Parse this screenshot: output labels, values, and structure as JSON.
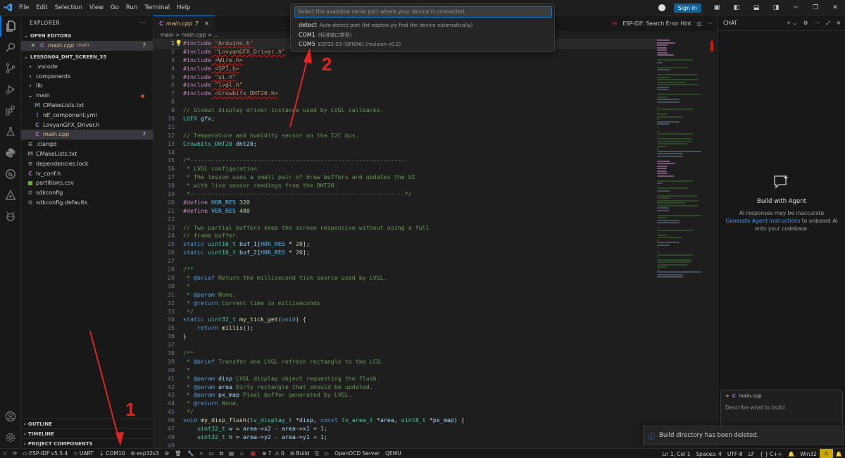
{
  "menu": [
    "File",
    "Edit",
    "Selection",
    "View",
    "Go",
    "Run",
    "Terminal",
    "Help"
  ],
  "title_right": {
    "sign_in": "Sign In"
  },
  "quickpick": {
    "placeholder": "Select the available serial port where your device is connected.",
    "items": [
      {
        "label": "detect",
        "desc": "Auto-detect port (let esptool.py find the device automatically)"
      },
      {
        "label": "COM1",
        "desc": "(标准端口类型)"
      },
      {
        "label": "COM5",
        "desc": "ESP32-S3 (QFN56) (revision v0.2)"
      }
    ]
  },
  "sidebar": {
    "header": "EXPLORER",
    "open_editors": "OPEN EDITORS",
    "open_file": {
      "name": "main.cpp",
      "folder": "main",
      "badge": "7"
    },
    "project": "LESSON04_DHT_SCREEN_35",
    "tree": [
      {
        "name": ".vscode",
        "kind": "folder",
        "depth": 1
      },
      {
        "name": "components",
        "kind": "folder",
        "depth": 1
      },
      {
        "name": "lib",
        "kind": "folder",
        "depth": 1
      },
      {
        "name": "main",
        "kind": "folder-open",
        "depth": 1
      },
      {
        "name": "CMakeLists.txt",
        "kind": "cmake",
        "depth": 2
      },
      {
        "name": "idf_component.yml",
        "kind": "yml",
        "depth": 2
      },
      {
        "name": "LovyanGFX_Driver.h",
        "kind": "h",
        "depth": 2
      },
      {
        "name": "main.cpp",
        "kind": "cpp",
        "depth": 2,
        "badge": "7"
      },
      {
        "name": ".clangd",
        "kind": "file",
        "depth": 1
      },
      {
        "name": "CMakeLists.txt",
        "kind": "cmake",
        "depth": 1
      },
      {
        "name": "dependencies.lock",
        "kind": "file",
        "depth": 1
      },
      {
        "name": "lv_conf.h",
        "kind": "h",
        "depth": 1
      },
      {
        "name": "partitions.csv",
        "kind": "csv",
        "depth": 1
      },
      {
        "name": "sdkconfig",
        "kind": "gear",
        "depth": 1
      },
      {
        "name": "sdkconfig.defaults",
        "kind": "gear",
        "depth": 1
      }
    ],
    "bottom_sections": [
      "OUTLINE",
      "TIMELINE",
      "PROJECT COMPONENTS"
    ]
  },
  "editor": {
    "tab": {
      "name": "main.cpp",
      "count": "7"
    },
    "tab_right": "ESP-IDF: Search Error Hint",
    "breadcrumbs": "main > main.cpp > ...",
    "lines": [
      "#include \"Arduino.h\"",
      "#include \"LovyanGFX_Driver.h\"",
      "#include <Wire.h>",
      "#include <SPI.h>",
      "#include \"ui.h\"",
      "#include \"lvgl.h\"",
      "#include <Crowbits_DHT20.h>",
      "",
      "// Global display driver instance used by LVGL callbacks.",
      "LGFX gfx;",
      "",
      "// Temperature and humidity sensor on the I2C bus.",
      "Crowbits_DHT20 dht20;",
      "",
      "/*-------------------------------------------------------------",
      " * LVGL configuration",
      " * The lesson uses a small pair of draw buffers and updates the UI",
      " * with live sensor readings from the DHT20.",
      " *-------------------------------------------------------------*/",
      "#define HOR_RES 320",
      "#define VER_RES 480",
      "",
      "// Two partial buffers keep the screen responsive without using a full",
      "// frame buffer.",
      "static uint16_t buf_1[HOR_RES * 20];",
      "static uint16_t buf_2[HOR_RES * 20];",
      "",
      "/**",
      " * @brief Return the millisecond tick source used by LVGL.",
      " *",
      " * @param None.",
      " * @return Current time in milliseconds.",
      " */",
      "static uint32_t my_tick_get(void) {",
      "    return millis();",
      "}",
      "",
      "/**",
      " * @brief Transfer one LVGL refresh rectangle to the LCD.",
      " *",
      " * @param disp LVGL display object requesting the flush.",
      " * @param area Dirty rectangle that should be updated.",
      " * @param px_map Pixel buffer generated by LVGL.",
      " * @return None.",
      " */",
      "void my_disp_flush(lv_display_t *disp, const lv_area_t *area, uint8_t *px_map) {",
      "    uint32_t w = area->x2 - area->x1 + 1;",
      "    uint32_t h = area->y2 - area->y1 + 1;",
      ""
    ]
  },
  "chat": {
    "header": "CHAT",
    "title": "Build with Agent",
    "text1": "AI responses may be inaccurate",
    "link": "Generate Agent Instructions",
    "text2": "to onboard AI",
    "text3": "onto your codebase.",
    "context_file": "main.cpp",
    "placeholder": "Describe what to build"
  },
  "toast": {
    "message": "Build directory has been deleted."
  },
  "statusbar": {
    "idf": "ESP-IDF v5.5.4",
    "uart": "UART",
    "com": "COM10",
    "target": "esp32s3",
    "problems_err": "7",
    "problems_warn": "0",
    "build": "Build",
    "openocd": "OpenOCD Server",
    "qemu": "QEMU",
    "position": "Ln 1, Col 1",
    "spaces": "Spaces: 4",
    "encoding": "UTF-8",
    "eol": "LF",
    "lang": "C++",
    "platform": "Win32"
  },
  "annotations": {
    "label1": "1",
    "label2": "2"
  },
  "colors": {
    "accent": "#0078d4",
    "annotation": "#e02424",
    "warning": "#cca700"
  }
}
